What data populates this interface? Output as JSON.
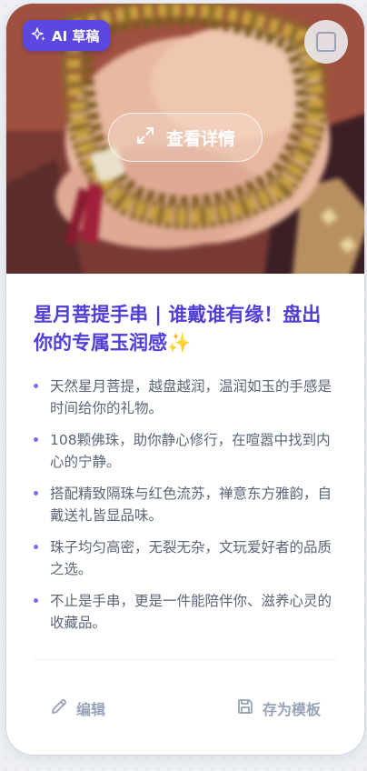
{
  "card": {
    "badge": {
      "label": "AI 草稿",
      "icon": "sparkle-icon"
    },
    "select_toggle": {
      "icon": "checkbox-icon",
      "checked": false
    },
    "view_details": {
      "label": "查看详情",
      "icon": "expand-icon"
    },
    "title": "星月菩提手串 | 谁戴谁有缘！盘出你的专属玉润感✨",
    "bullets": [
      "天然星月菩提，越盘越润，温润如玉的手感是时间给你的礼物。",
      "108颗佛珠，助你静心修行，在喧嚣中找到内心的宁静。",
      "搭配精致隔珠与红色流苏，禅意东方雅韵，自戴送礼皆显品味。",
      "珠子均匀高密，无裂无杂，文玩爱好者的品质之选。",
      "不止是手串，更是一件能陪伴你、滋养心灵的收藏品。"
    ],
    "actions": {
      "edit": {
        "label": "编辑",
        "icon": "pencil-icon"
      },
      "save_template": {
        "label": "存为模板",
        "icon": "save-icon"
      }
    }
  },
  "colors": {
    "accent": "#4f3fd6",
    "badge_bg": "#5b48e0",
    "bullet_text": "#5b6577",
    "bullet_dot": "#7a6ff0",
    "action_text": "#98a3b8"
  }
}
